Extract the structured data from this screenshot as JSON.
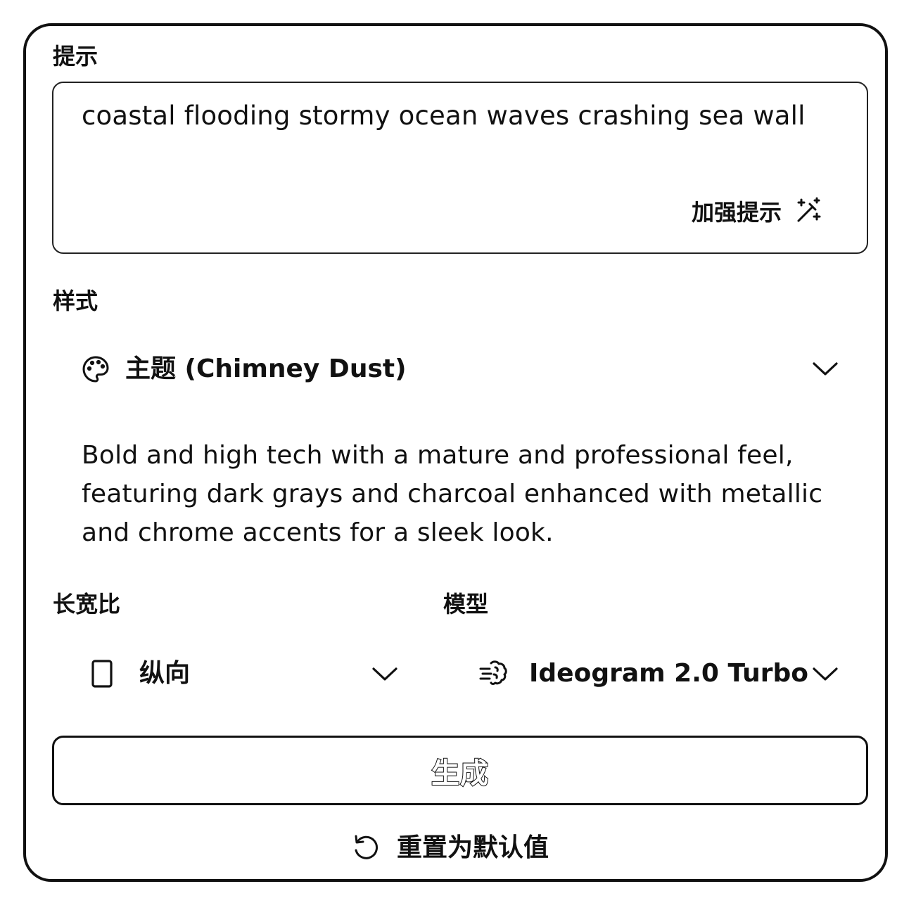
{
  "prompt": {
    "label": "提示",
    "value": "coastal flooding stormy ocean waves crashing sea wall",
    "enhance_label": "加强提示",
    "enhance_icon": "magic-wand-icon"
  },
  "style": {
    "label": "样式",
    "selected": "主题 (Chimney Dust)",
    "icon": "palette-icon",
    "description": "Bold and high tech with a mature and professional feel, featuring dark grays and charcoal enhanced with metallic and chrome accents for a sleek look."
  },
  "aspect_ratio": {
    "label": "长宽比",
    "selected": "纵向",
    "icon": "portrait-rectangle-icon"
  },
  "model": {
    "label": "模型",
    "selected": "Ideogram 2.0 Turbo",
    "icon": "brain-speed-icon"
  },
  "actions": {
    "generate_label": "生成",
    "reset_label": "重置为默认值",
    "reset_icon": "undo-icon"
  }
}
